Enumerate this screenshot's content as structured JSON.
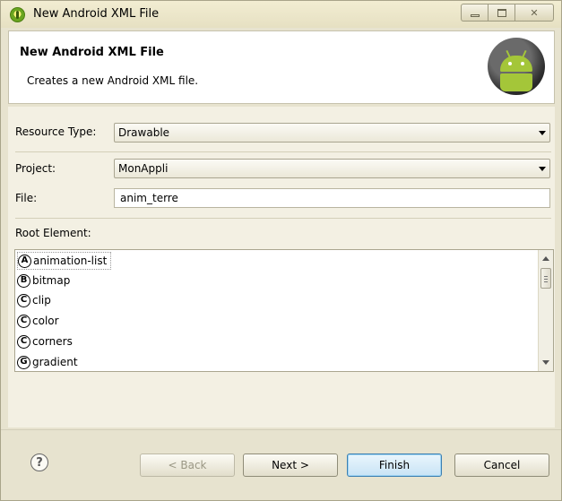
{
  "window": {
    "title": "New Android XML File"
  },
  "header": {
    "title": "New Android XML File",
    "description": "Creates a new Android XML file."
  },
  "form": {
    "resource_type_label": "Resource Type:",
    "resource_type_value": "Drawable",
    "project_label": "Project:",
    "project_value": "MonAppli",
    "file_label": "File:",
    "file_value": "anim_terre",
    "root_element_label": "Root Element:"
  },
  "root_elements": [
    {
      "letter": "A",
      "name": "animation-list",
      "selected": true
    },
    {
      "letter": "B",
      "name": "bitmap"
    },
    {
      "letter": "C",
      "name": "clip"
    },
    {
      "letter": "C",
      "name": "color"
    },
    {
      "letter": "C",
      "name": "corners"
    },
    {
      "letter": "G",
      "name": "gradient"
    }
  ],
  "buttons": {
    "help": "?",
    "back": "< Back",
    "next": "Next >",
    "finish": "Finish",
    "cancel": "Cancel"
  }
}
